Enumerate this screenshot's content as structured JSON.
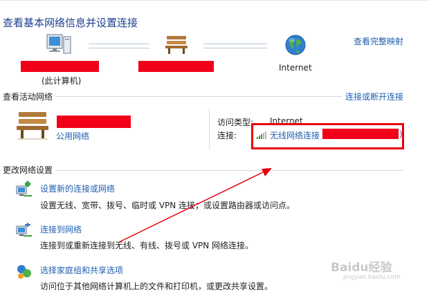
{
  "header": {
    "title": "查看基本网络信息并设置连接",
    "full_map_link": "查看完整映射"
  },
  "map": {
    "computer_label": "(此计算机)",
    "internet_label": "Internet"
  },
  "active_networks": {
    "section_label": "查看活动网络",
    "connect_disconnect_link": "连接或断开连接",
    "network_type_link": "公用网络",
    "access_type_label": "访问类型:",
    "access_type_value": "Internet",
    "connection_label": "连接:",
    "connection_link": "无线网络连接",
    "connection_link_suffix": ")"
  },
  "change_settings": {
    "section_label": "更改网络设置",
    "tasks": [
      {
        "title": "设置新的连接或网络",
        "desc": "设置无线、宽带、拨号、临时或 VPN 连接；或设置路由器或访问点。"
      },
      {
        "title": "连接到网络",
        "desc": "连接到或重新连接到无线、有线、拨号或 VPN 网络连接。"
      },
      {
        "title": "选择家庭组和共享选项",
        "desc": "访问位于其他网络计算机上的文件和打印机，或更改共享设置。"
      }
    ]
  },
  "annotation": {
    "highlight_color": "#e8000d",
    "arrow_color": "#e8000d"
  },
  "watermark": {
    "text": "Baidu经验",
    "subtext": "jingyan.baidu.com"
  },
  "colors": {
    "link": "#1d5fb0",
    "title": "#1c3f8c",
    "redaction": "#f2001a"
  }
}
